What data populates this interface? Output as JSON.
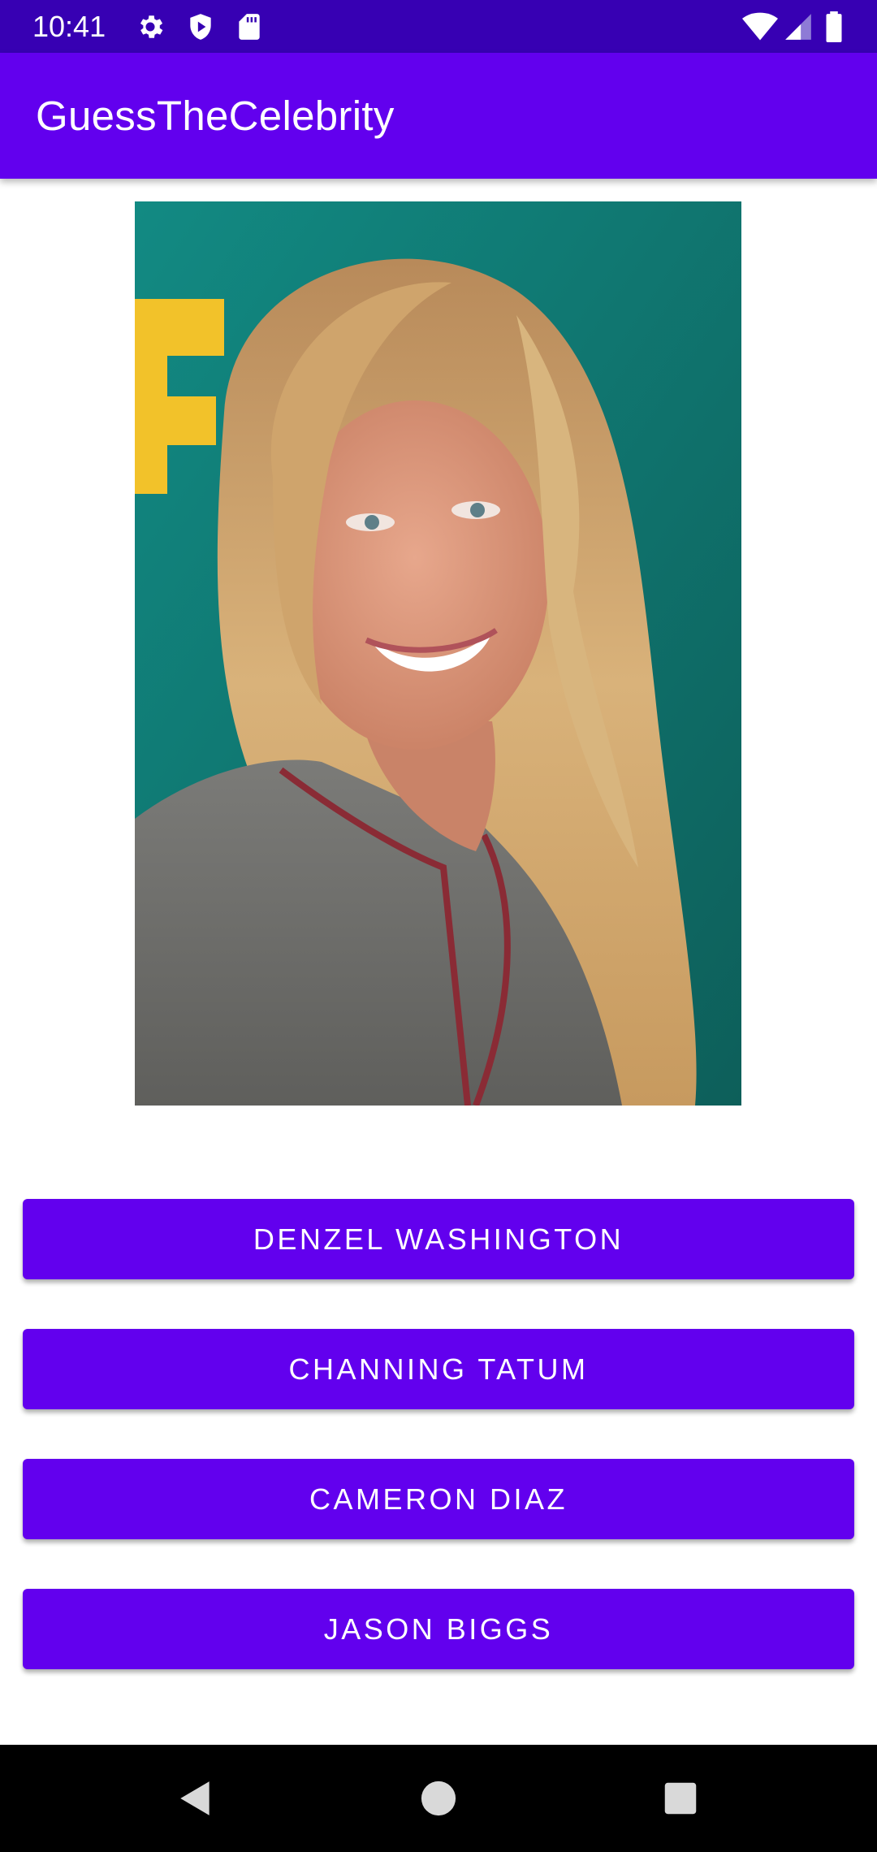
{
  "status_bar": {
    "time": "10:41",
    "left_icons": [
      "settings-icon",
      "shield-play-icon",
      "sd-card-icon"
    ],
    "right_icons": [
      "wifi-icon",
      "signal-icon",
      "battery-icon"
    ],
    "background": "#3700b3"
  },
  "app_bar": {
    "title": "GuessTheCelebrity",
    "background": "#6200ee"
  },
  "celebrity_image": {
    "description_icon": "celebrity-photo"
  },
  "answers": [
    {
      "label": "DENZEL WASHINGTON"
    },
    {
      "label": "CHANNING TATUM"
    },
    {
      "label": "CAMERON DIAZ"
    },
    {
      "label": "JASON BIGGS"
    }
  ],
  "nav_bar": {
    "buttons": [
      "back-icon",
      "home-icon",
      "recents-icon"
    ]
  },
  "colors": {
    "primary": "#6200ee",
    "primary_dark": "#3700b3",
    "on_primary": "#ffffff"
  }
}
